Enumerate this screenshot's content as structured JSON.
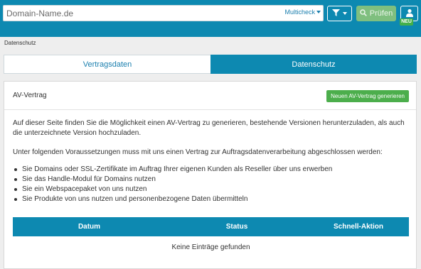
{
  "topbar": {
    "search_placeholder": "Domain-Name.de",
    "multicheck_label": "Multicheck",
    "pruefen_label": "Prüfen",
    "neu_badge": "NEU"
  },
  "breadcrumb": "Datenschutz",
  "tabs": [
    {
      "label": "Vertragsdaten",
      "active": false
    },
    {
      "label": "Datenschutz",
      "active": true
    }
  ],
  "panel": {
    "title": "AV-Vertrag",
    "new_button": "Neuen AV-Vertrag generieren",
    "intro": "Auf dieser Seite finden Sie die Möglichkeit einen AV-Vertrag zu generieren, bestehende Versionen herunterzuladen, als auch die unterzeichnete Version hochzuladen.",
    "conditions_heading": "Unter folgenden Voraussetzungen muss mit uns einen Vertrag zur Auftragsdatenverarbeitung abgeschlossen werden:",
    "conditions": [
      "Sie Domains oder SSL-Zertifikate im Auftrag Ihrer eigenen Kunden als Reseller über uns erwerben",
      "Sie das Handle-Modul für Domains nutzen",
      "Sie ein Webspacepaket von uns nutzen",
      "Sie Produkte von uns nutzen und personenbezogene Daten übermitteln"
    ]
  },
  "table": {
    "columns": [
      "Datum",
      "Status",
      "Schnell-Aktion"
    ],
    "empty_text": "Keine Einträge gefunden"
  },
  "colors": {
    "brand": "#0d89b1",
    "success": "#4cae4c"
  },
  "icons": [
    "filter-icon",
    "chevron-down-icon",
    "search-icon",
    "user-icon"
  ]
}
